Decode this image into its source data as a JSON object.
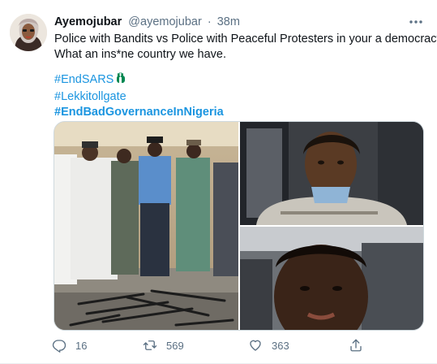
{
  "tweet": {
    "author_name": "Ayemojubar",
    "author_handle": "@ayemojubar",
    "separator": "·",
    "time": "38m",
    "text_line1": "Police with Bandits vs Police with Peaceful Protesters in your a democracy.",
    "text_line2": "What an ins*ne country we have.",
    "hashtags": [
      "#EndSARS",
      "#Lekkitollgate",
      "#EndBadGovernanceInNigeria"
    ],
    "flag_emoji": "raised-fist-emoji-green"
  },
  "actions": {
    "reply_count": "16",
    "retweet_count": "569",
    "like_count": "363"
  },
  "colors": {
    "link": "#1b95e0",
    "muted": "#5b7083",
    "text": "#0f1419",
    "border": "#cfd9de"
  },
  "icons": {
    "more": "more-options-icon",
    "reply": "reply-icon",
    "retweet": "retweet-icon",
    "like": "heart-icon",
    "share": "share-icon"
  }
}
